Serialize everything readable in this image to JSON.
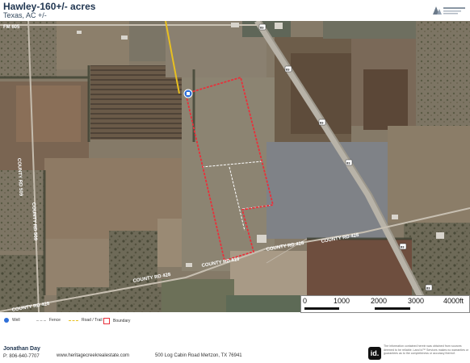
{
  "header": {
    "title": "Hawley-160+/- acres",
    "subtitle": "Texas, AC +/-"
  },
  "map": {
    "road_labels": {
      "fm605": "FM 605",
      "county_rd_509_upper": "COUNTY RD 509",
      "county_rd_509_lower": "COUNTY RD 509",
      "county_rd_428_right": "COUNTY RD 428",
      "county_rd_428_mid": "COUNTY RD 428",
      "county_rd_428_left": "COUNTY RD 428",
      "county_rd_410": "COUNTY RD 410"
    },
    "highway_shield": "83",
    "scale": {
      "labels": [
        "0",
        "1000",
        "2000",
        "3000",
        "4000ft"
      ]
    },
    "colors": {
      "boundary": "#e8303a",
      "road_trail": "#e8c020",
      "fence": "#ffffff",
      "well": "#2e6fd8"
    }
  },
  "legend": {
    "well": "Well",
    "fence": "Fence",
    "road_trail": "Road / Trail",
    "boundary": "Boundary"
  },
  "footer": {
    "agent_name": "Jonathan Day",
    "agent_phone": "P: 806-640-7707",
    "website": "www.heritagecreekrealestate.com",
    "address": "500 Log Cabin Road Mertzon, TX 76941",
    "id_logo": "id.",
    "disclaimer": "The information contained herein was obtained from sources deemed to be reliable. Land id™ Services makes no warranties or guarantees as to the completeness or accuracy thereof."
  }
}
